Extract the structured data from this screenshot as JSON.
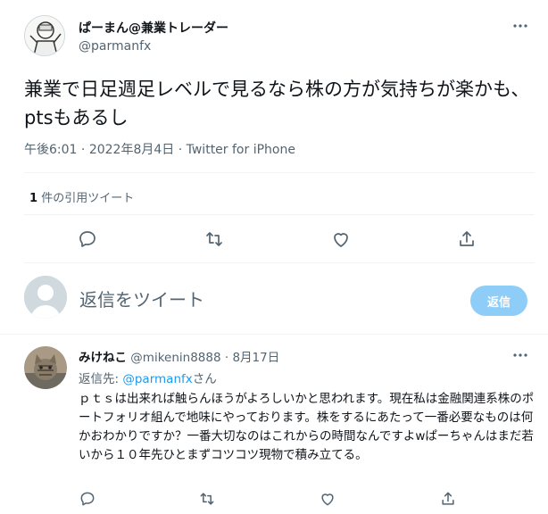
{
  "tweet": {
    "display_name": "ぱーまん@兼業トレーダー",
    "handle": "@parmanfx",
    "text": "兼業で日足週足レベルで見るなら株の方が気持ちが楽かも、ptsもあるし",
    "time": "午後6:01",
    "date": "2022年8月4日",
    "client": "Twitter for iPhone",
    "quote_count": "1",
    "quote_label": "件の引用ツイート",
    "more_icon": "more-icon"
  },
  "composer": {
    "placeholder": "返信をツイート",
    "button_label": "返信"
  },
  "reply": {
    "display_name": "みけねこ",
    "handle": "@mikenin8888",
    "date": "8月17日",
    "reply_to_prefix": "返信先:",
    "reply_to_handle": "@parmanfx",
    "reply_to_suffix": "さん",
    "text": "ｐｔｓは出来れば触らんほうがよろしいかと思われます。現在私は金融関連系株のポートフォリオ組んで地味にやっております。株をするにあたって一番必要なものは何かおわかりですか？一番大切なのはこれからの時間なんですよwぱーちゃんはまだ若いから１０年先ひとまずコツコツ現物で積み立てる。"
  },
  "colors": {
    "accent": "#1d9bf0",
    "button_disabled": "#8ecdf8",
    "muted_text": "#536471"
  }
}
